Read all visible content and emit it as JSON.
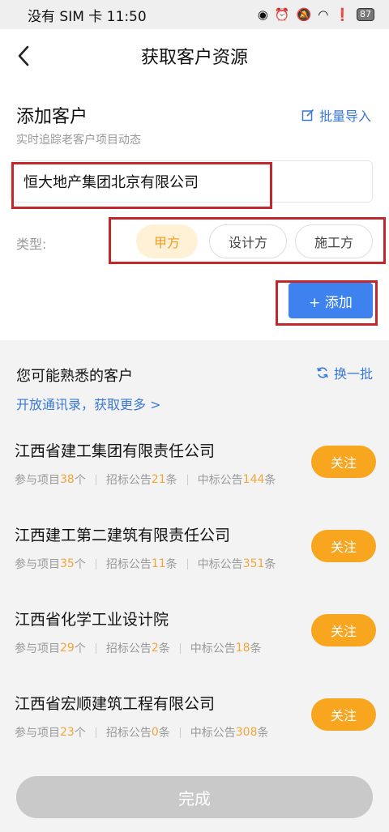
{
  "status_bar": {
    "left": "没有 SIM 卡 11:50",
    "battery": "87"
  },
  "nav": {
    "title": "获取客户资源"
  },
  "add_customer": {
    "title": "添加客户",
    "subtitle": "实时追踪老客户项目动态",
    "batch_import": "批量导入",
    "input_value": "恒大地产集团北京有限公司",
    "type_label": "类型:",
    "types": [
      "甲方",
      "设计方",
      "施工方"
    ],
    "selected_type": "甲方",
    "add_button": "+ 添加"
  },
  "familiar": {
    "title": "您可能熟悉的客户",
    "refresh": "换一批",
    "open_contacts": "开放通讯录，获取更多 >",
    "stat_labels": {
      "projects": "参与项目",
      "projects_unit": "个",
      "tenders": "招标公告",
      "tenders_unit": "条",
      "wins": "中标公告",
      "wins_unit": "条"
    },
    "follow_label": "关注",
    "companies": [
      {
        "name": "江西省建工集团有限责任公司",
        "projects": "38",
        "tenders": "21",
        "wins": "144"
      },
      {
        "name": "江西建工第二建筑有限责任公司",
        "projects": "35",
        "tenders": "11",
        "wins": "351"
      },
      {
        "name": "江西省化学工业设计院",
        "projects": "29",
        "tenders": "2",
        "wins": "18"
      },
      {
        "name": "江西省宏顺建筑工程有限公司",
        "projects": "23",
        "tenders": "0",
        "wins": "308"
      }
    ]
  },
  "footer": {
    "done_button": "完成"
  }
}
